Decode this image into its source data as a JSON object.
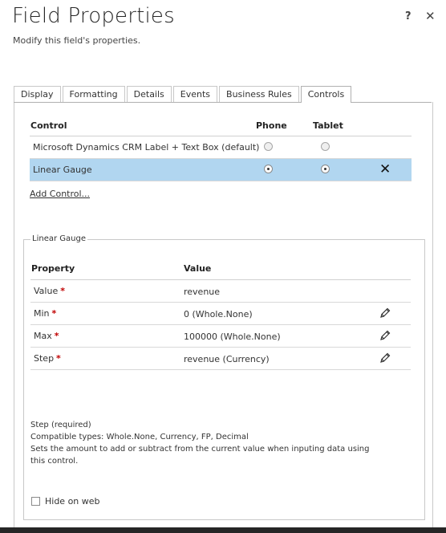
{
  "dialog": {
    "title": "Field Properties",
    "subtitle": "Modify this field's properties.",
    "help_label": "?",
    "close_label": "✕"
  },
  "tabs": [
    {
      "label": "Display"
    },
    {
      "label": "Formatting"
    },
    {
      "label": "Details"
    },
    {
      "label": "Events"
    },
    {
      "label": "Business Rules"
    },
    {
      "label": "Controls",
      "active": true
    }
  ],
  "controls_table": {
    "headers": {
      "control": "Control",
      "phone": "Phone",
      "tablet": "Tablet"
    },
    "rows": [
      {
        "name": "Microsoft Dynamics CRM Label + Text Box (default)",
        "phone": false,
        "tablet": false,
        "selected": false
      },
      {
        "name": "Linear Gauge",
        "phone": true,
        "tablet": true,
        "selected": true,
        "remove_label": "✕"
      }
    ],
    "add_control": "Add Control..."
  },
  "gauge_props": {
    "legend": "Linear Gauge",
    "headers": {
      "property": "Property",
      "value": "Value"
    },
    "rows": [
      {
        "name": "Value",
        "required": "*",
        "value": "revenue",
        "editable": false
      },
      {
        "name": "Min",
        "required": "*",
        "value": "0 (Whole.None)",
        "editable": true
      },
      {
        "name": "Max",
        "required": "*",
        "value": "100000 (Whole.None)",
        "editable": true
      },
      {
        "name": "Step",
        "required": "*",
        "value": "revenue (Currency)",
        "editable": true
      }
    ],
    "description": {
      "line1": "Step (required)",
      "line2": "Compatible types: Whole.None, Currency, FP, Decimal",
      "line3": "Sets the amount to add or subtract from the current value when inputing data using this control."
    },
    "hide_on_web": {
      "label": "Hide on web",
      "checked": false
    }
  },
  "colors": {
    "selected_row": "#b1d6f0",
    "required": "#c00000",
    "bottom_bar": "#262626"
  }
}
